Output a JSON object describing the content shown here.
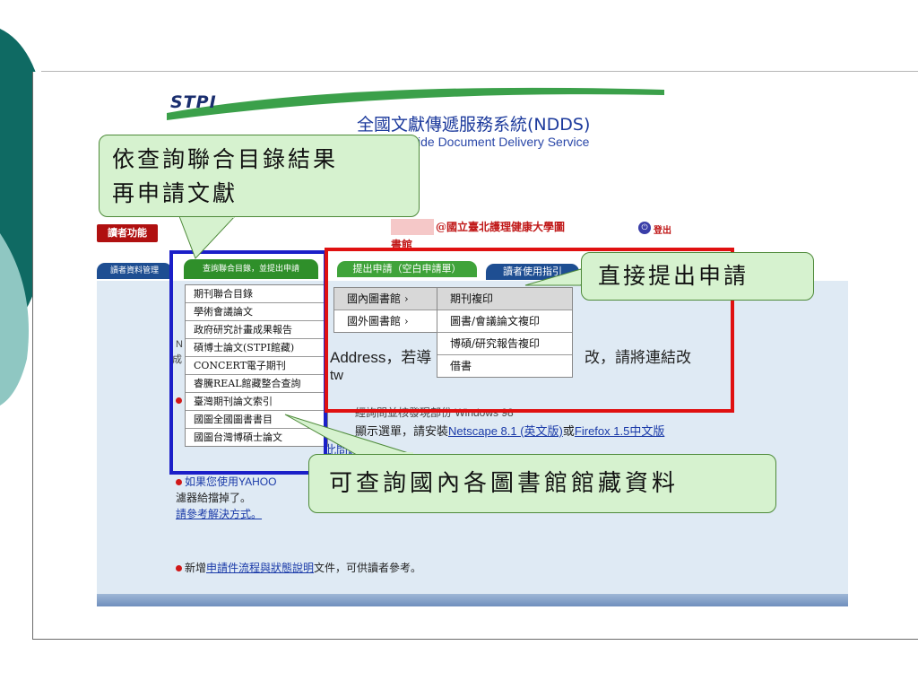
{
  "header": {
    "logo": "STPI",
    "title": "全國文獻傳遞服務系統(NDDS)",
    "subtitle": "ide Document Delivery Service"
  },
  "login": {
    "reader_function": "讀者功能",
    "library_name": "@國立臺北護理健康大學圖",
    "library_name_cont": "書館",
    "logout": "登出"
  },
  "tabs": {
    "reader_data": "讀者資料管理",
    "union_catalog": "查詢聯合目錄，並提出申請",
    "apply": "提出申請（空白申請單）",
    "guide": "讀者使用指引"
  },
  "union_menu": [
    "期刊聯合目錄",
    "學術會議論文",
    "政府研究計畫成果報告",
    "碩博士論文(STPI館藏)",
    "CONCERT電子期刊",
    "睿騰REAL館藏整合查詢",
    "臺灣期刊論文索引",
    "國圖全國圖書書目",
    "國圖台灣博碩士論文"
  ],
  "apply_menu": [
    {
      "label": "國內圖書館 ›",
      "selected": true
    },
    {
      "label": "國外圖書館 ›",
      "selected": false
    }
  ],
  "apply_submenu": [
    {
      "label": "期刊複印",
      "selected": true
    },
    {
      "label": "圖書/會議論文複印",
      "selected": false
    },
    {
      "label": "博碩/研究報告複印",
      "selected": false
    },
    {
      "label": "借書",
      "selected": false
    }
  ],
  "background_text": {
    "address": "Address，若導",
    "address_tail": "改，請將連結改",
    "tw": "tw",
    "windows": "經詢問並核發現部份 Windows 98",
    "browser_prefix": "顯示選單，請安裝",
    "netscape": "Netscape 8.1 (英文版)",
    "or": "或",
    "firefox": "Firefox 1.5中文版",
    "problem": "此問題。",
    "yahoo_line1": "如果您使用YAHOO",
    "yahoo_line2": "濾器給擋掉了。",
    "yahoo_link": "請參考解決方式",
    "yahoo_period": "。",
    "news_prefix": "新增",
    "news_link": "申請件流程與狀態說明",
    "news_suffix": "文件，可供讀者參考。",
    "n_marker": "N",
    "n_marker2": "成"
  },
  "callouts": {
    "union": [
      "依查詢聯合目錄結果",
      "再申請文獻"
    ],
    "direct": "直接提出申請",
    "domestic": "可查詢國內各圖書館館藏資料"
  },
  "colors": {
    "teal_deco": "#0f6a63",
    "callout_bg": "#d6f2cf",
    "blue_highlight": "#1b1fc8",
    "red_highlight": "#e01010"
  }
}
